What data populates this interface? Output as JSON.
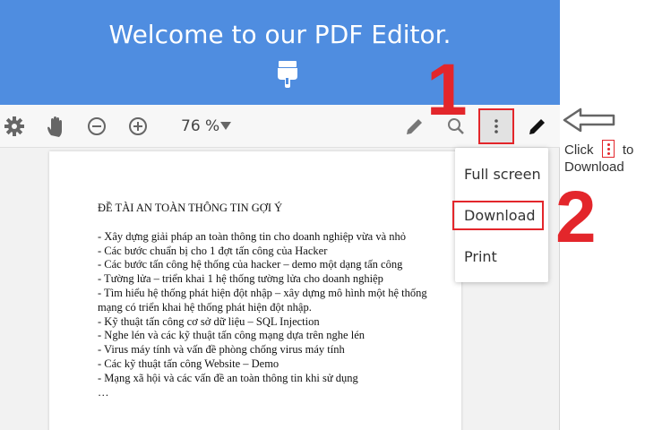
{
  "banner": {
    "title": "Welcome to our PDF Editor."
  },
  "toolbar": {
    "zoom_value": "76 %",
    "icons": [
      "gear-icon",
      "hand-icon",
      "zoom-out-icon",
      "zoom-in-icon",
      "zoom-dropdown-icon",
      "pencil-icon",
      "search-icon",
      "more-vert-icon",
      "pen-icon"
    ]
  },
  "menu": {
    "items": [
      {
        "label": "Full screen"
      },
      {
        "label": "Download"
      },
      {
        "label": "Print"
      }
    ]
  },
  "document": {
    "title": "ĐỀ TÀI AN TOÀN THÔNG TIN GỢI Ý",
    "lines": [
      "- Xây dựng giải pháp an toàn thông tin cho doanh nghiệp vừa và nhỏ",
      "- Các bước chuẩn bị cho 1 đợt tấn công của Hacker",
      "- Các bước tấn công hệ thống của hacker – demo một dạng tấn công",
      "- Tường lửa – triển khai 1 hệ thống tường lửa cho doanh nghiệp",
      "- Tìm hiểu hệ thống phát hiện đột nhập – xây dựng mô hình một hệ thống mạng có triển khai hệ thống phát hiện đột nhập.",
      "- Kỹ thuật tấn công cơ sở dữ liệu – SQL Injection",
      "- Nghe lén và các kỹ thuật tấn công mạng dựa trên nghe lén",
      "- Virus máy tính và vấn đề phòng chống virus máy tính",
      "- Các kỹ thuật tấn công Website – Demo",
      "- Mạng xã hội và các vấn đề an toàn thông tin khi sử dụng",
      "…"
    ]
  },
  "annotations": {
    "step1": "1",
    "step2": "2",
    "hint_click": "Click",
    "hint_to": "to",
    "hint_download": "Download"
  },
  "colors": {
    "banner": "#4f8de0",
    "highlight": "#e3262b"
  }
}
